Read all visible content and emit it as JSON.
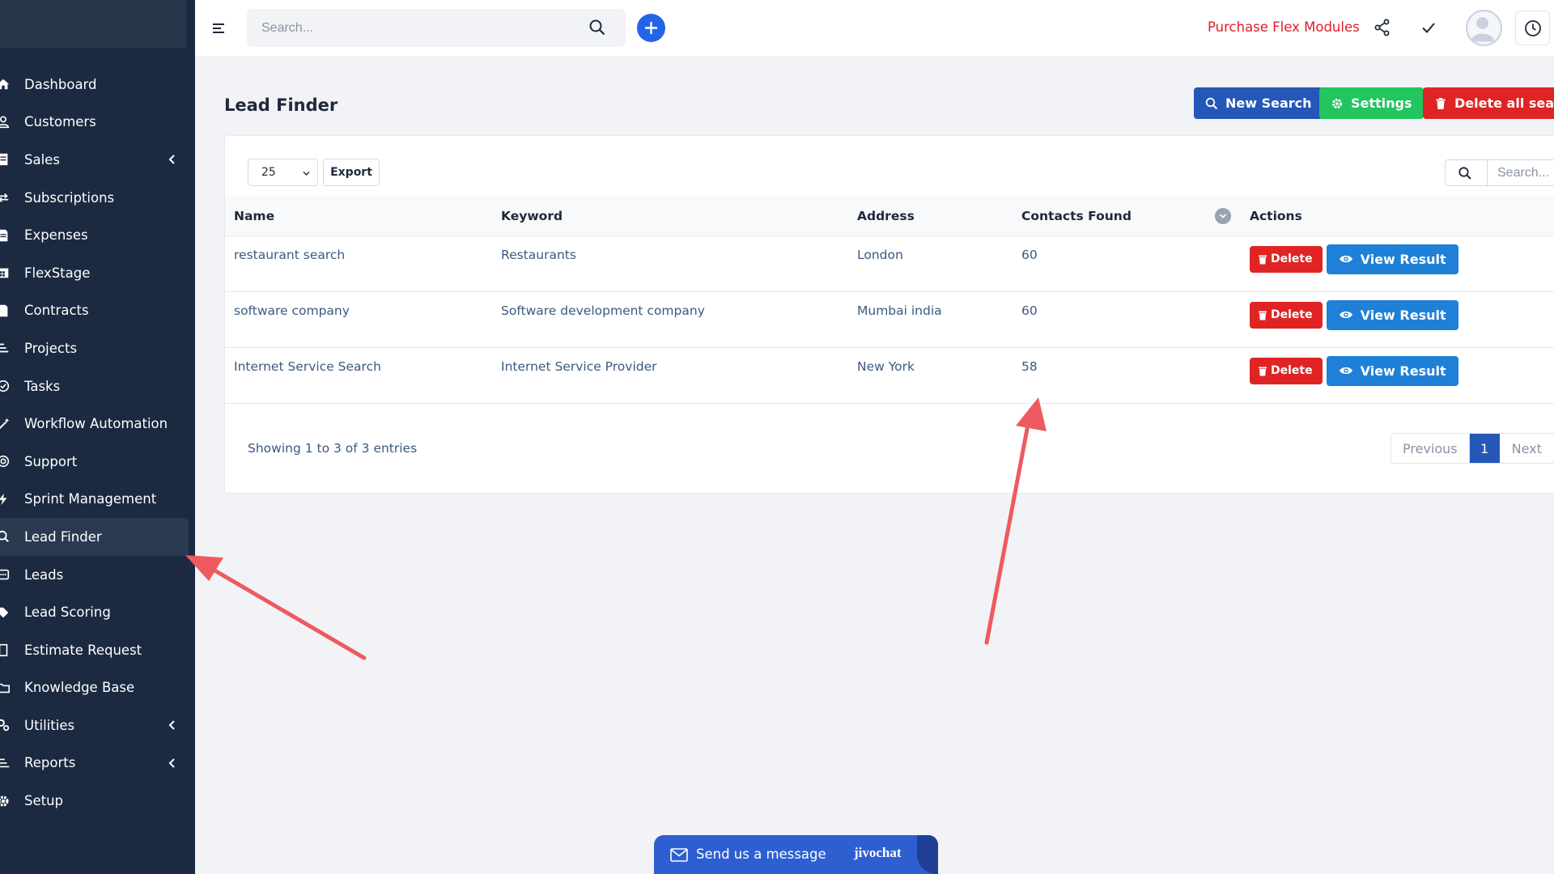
{
  "sidebar": {
    "items": [
      {
        "label": "Dashboard",
        "icon": "home-icon"
      },
      {
        "label": "Customers",
        "icon": "user-icon"
      },
      {
        "label": "Sales",
        "icon": "receipt-icon"
      },
      {
        "label": "Subscriptions",
        "icon": "repeat-icon"
      },
      {
        "label": "Expenses",
        "icon": "file-icon"
      },
      {
        "label": "FlexStage",
        "icon": "calendar-icon"
      },
      {
        "label": "Contracts",
        "icon": "contract-icon"
      },
      {
        "label": "Projects",
        "icon": "bars-icon"
      },
      {
        "label": "Tasks",
        "icon": "check-circle-icon"
      },
      {
        "label": "Workflow Automation",
        "icon": "wand-icon"
      },
      {
        "label": "Support",
        "icon": "lifebuoy-icon"
      },
      {
        "label": "Sprint Management",
        "icon": "bolt-icon"
      },
      {
        "label": "Lead Finder",
        "icon": "search-icon"
      },
      {
        "label": "Leads",
        "icon": "phone-icon"
      },
      {
        "label": "Lead Scoring",
        "icon": "tag-icon"
      },
      {
        "label": "Estimate Request",
        "icon": "clipboard-icon"
      },
      {
        "label": "Knowledge Base",
        "icon": "folder-icon"
      },
      {
        "label": "Utilities",
        "icon": "cogs-icon"
      },
      {
        "label": "Reports",
        "icon": "report-icon"
      },
      {
        "label": "Setup",
        "icon": "gear-icon"
      }
    ]
  },
  "topbar": {
    "search_placeholder": "Search...",
    "purchase_label": "Purchase Flex Modules"
  },
  "page": {
    "title": "Lead Finder",
    "new_search_label": "New Search",
    "settings_label": "Settings",
    "delete_all_label": "Delete all search"
  },
  "table": {
    "page_length": "25",
    "export_label": "Export",
    "search_placeholder": "Search...",
    "columns": [
      "Name",
      "Keyword",
      "Address",
      "Contacts Found",
      "Actions"
    ],
    "rows": [
      {
        "name": "restaurant search",
        "keyword": "Restaurants",
        "address": "London",
        "contacts": "60",
        "delete": "Delete",
        "view": "View Result"
      },
      {
        "name": "software company",
        "keyword": "Software development company",
        "address": "Mumbai india",
        "contacts": "60",
        "delete": "Delete",
        "view": "View Result"
      },
      {
        "name": "Internet Service Search",
        "keyword": "Internet Service Provider",
        "address": "New York",
        "contacts": "58",
        "delete": "Delete",
        "view": "View Result"
      }
    ],
    "info": "Showing 1 to 3 of 3 entries",
    "pagination": {
      "previous": "Previous",
      "current": "1",
      "next": "Next"
    }
  },
  "chat": {
    "message": "Send us a message",
    "brand": "jivochat"
  },
  "colors": {
    "sidebar_bg": "#1b2a41",
    "primary": "#2457b7",
    "success": "#22c55e",
    "danger": "#e02424",
    "info": "#1e80d6",
    "annotation_arrow": "#ee5a5f"
  }
}
